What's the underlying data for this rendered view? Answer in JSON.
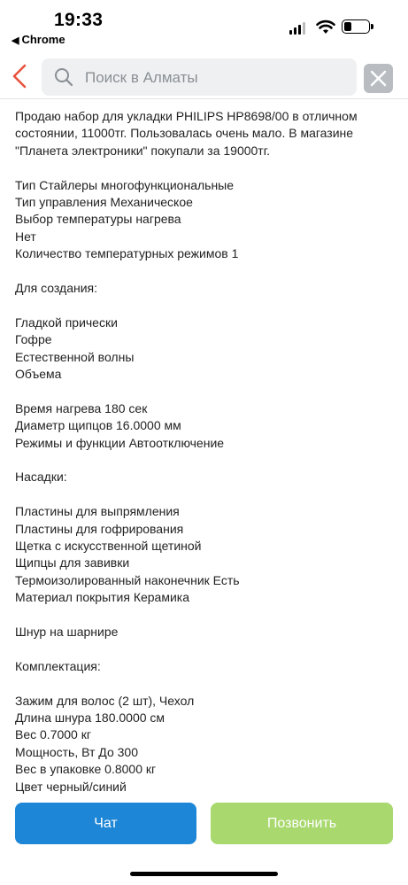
{
  "status_bar": {
    "time": "19:33",
    "back_app": "Chrome",
    "back_arrow": "◀"
  },
  "header": {
    "search_placeholder": "Поиск в Алматы",
    "accent_color": "#e8533f"
  },
  "description": {
    "lines": [
      "Продаю набор для укладки PHILIPS HP8698/00 в отличном состоянии, 11000тг. Пользовалась очень мало. В магазине \"Планета электроники\" покупали за 19000тг.",
      "",
      "Тип Стайлеры многофункциональные",
      "Тип управления Механическое",
      "Выбор температуры нагрева",
      "Нет",
      "Количество температурных режимов 1",
      "",
      "Для создания:",
      "",
      "Гладкой прически",
      "Гофре",
      "Естественной волны",
      "Объема",
      "",
      "Время нагрева 180 сек",
      "Диаметр щипцов 16.0000 мм",
      "Режимы и функции Автоотключение",
      "",
      "Насадки:",
      "",
      "Пластины для выпрямления",
      "Пластины для гофрирования",
      "Щетка с искусственной щетиной",
      "Щипцы для завивки",
      "Термоизолированный наконечник Есть",
      "Материал покрытия Керамика",
      "",
      "Шнур на шарнире",
      "",
      "Комплектация:",
      "",
      "Зажим для волос (2 шт), Чехол",
      "Длина шнура 180.0000 см",
      "Вес 0.7000 кг",
      "Мощность, Вт До 300",
      "Вес в упаковке 0.8000 кг",
      "Цвет черный/синий"
    ]
  },
  "actions": {
    "chat_label": "Чат",
    "call_label": "Позвонить",
    "chat_color": "#1d86d6",
    "call_color": "#a8d86e"
  }
}
